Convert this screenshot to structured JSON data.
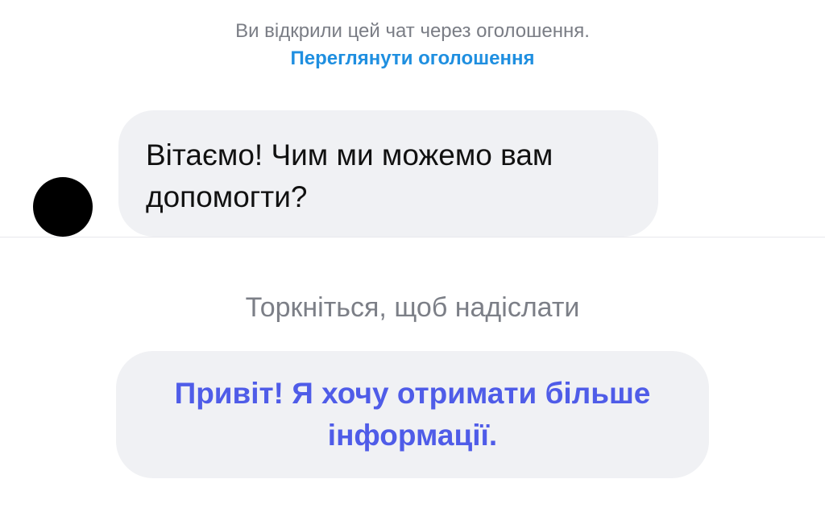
{
  "ad_notice": {
    "text": "Ви відкрили цей чат через оголошення.",
    "link_label": "Переглянути оголошення"
  },
  "conversation": {
    "incoming_message": "Вітаємо! Чим ми можемо вам допомогти?"
  },
  "composer": {
    "tap_hint": "Торкніться, щоб надіслати",
    "quick_reply": "Привіт! Я хочу отримати більше інформації."
  },
  "colors": {
    "link": "#1f8fe0",
    "quick_reply_text": "#4f5ce8",
    "bubble_bg": "#f0f1f4",
    "muted_text": "#7a7d85"
  }
}
